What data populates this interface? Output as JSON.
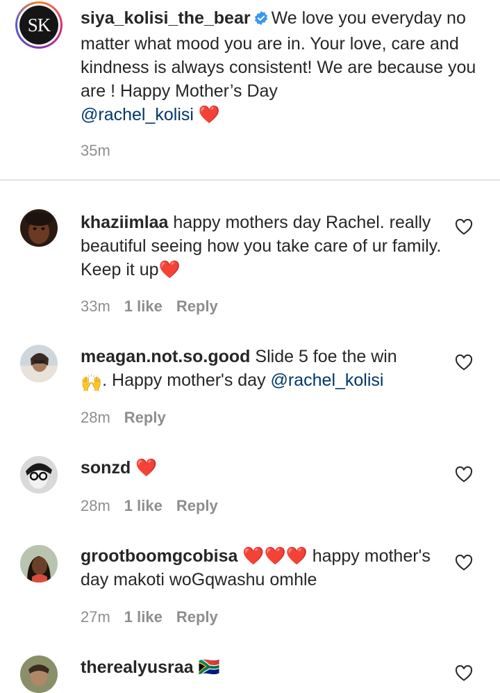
{
  "post": {
    "username": "siya_kolisi_the_bear",
    "avatar_monogram": "SK",
    "caption": "We love you everyday no matter what mood you are in. Your love, care and kindness is always consistent! We are because you are ! Happy Mother’s Day",
    "mention": "@rachel_kolisi",
    "heart": "❤️",
    "time": "35m"
  },
  "comments": [
    {
      "username": "khaziimlaa",
      "text": "happy mothers day Rachel. really beautiful seeing how you take care of ur family. Keep it up",
      "emoji": "❤️",
      "time": "33m",
      "likes": "1 like",
      "reply": "Reply"
    },
    {
      "username": "meagan.not.so.good",
      "text": "Slide 5 foe the win",
      "emoji": "🙌",
      "text2": ". Happy mother's day",
      "mention": "@rachel_kolisi",
      "time": "28m",
      "reply": "Reply"
    },
    {
      "username": "sonzd",
      "emoji": "❤️",
      "time": "28m",
      "likes": "1 like",
      "reply": "Reply"
    },
    {
      "username": "grootboomgcobisa",
      "emoji": "❤️❤️❤️",
      "text": "happy mother's day makoti woGqwashu omhle",
      "time": "27m",
      "likes": "1 like",
      "reply": "Reply"
    },
    {
      "username": "therealyusraa",
      "emoji": "🇿🇦"
    }
  ],
  "icons": {
    "like": "heart-outline-icon",
    "verified": "verified-badge-icon"
  },
  "colors": {
    "mention": "#00376b",
    "heart": "#ed1e28",
    "meta": "#8e8e8e",
    "verified": "#3897f0"
  }
}
